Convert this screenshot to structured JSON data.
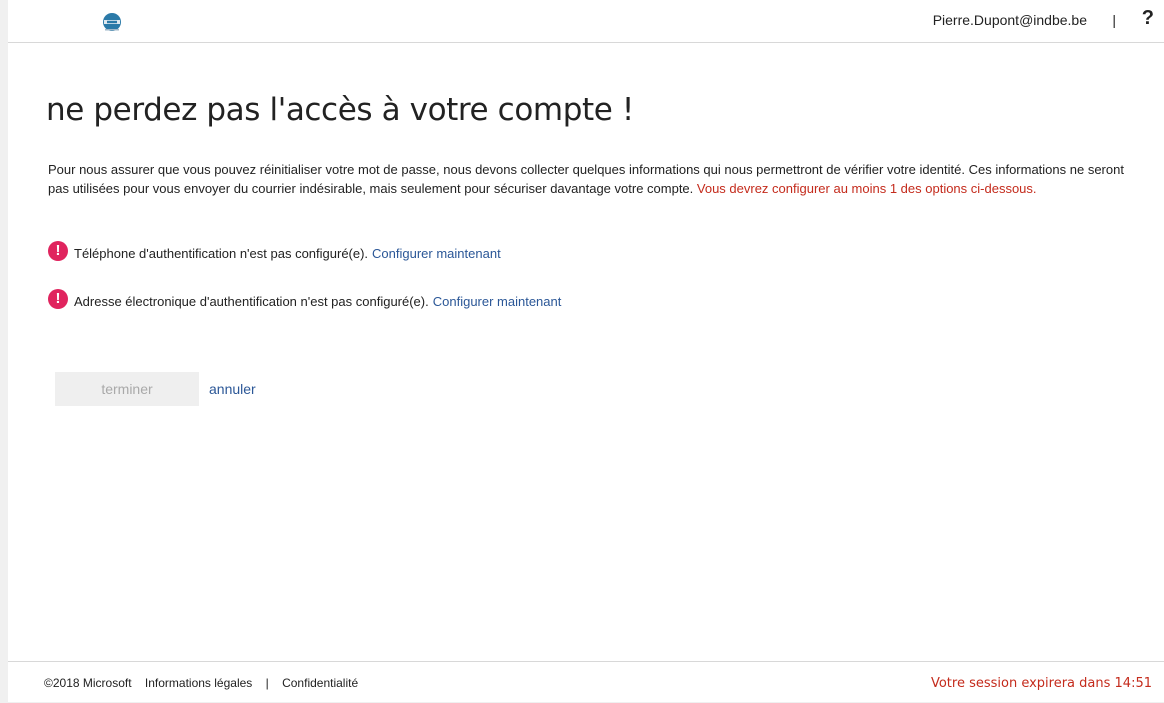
{
  "header": {
    "user_email": "Pierre.Dupont@indbe.be",
    "separator": "|",
    "help_label": "?"
  },
  "main": {
    "title": "ne perdez pas l'accès à votre compte !",
    "intro_text": "Pour nous assurer que vous pouvez réinitialiser votre mot de passe, nous devons collecter quelques informations qui nous permettront de vérifier votre identité. Ces informations ne seront pas utilisées pour vous envoyer du courrier indésirable, mais seulement pour sécuriser davantage votre compte. ",
    "intro_warning": "Vous devrez configurer au moins 1 des options ci-dessous.",
    "options": [
      {
        "status_text": "Téléphone d'authentification n'est pas configuré(e).",
        "link_label": "Configurer maintenant",
        "icon": "exclamation-icon"
      },
      {
        "status_text": "Adresse électronique d'authentification n'est pas configuré(e).",
        "link_label": "Configurer maintenant",
        "icon": "exclamation-icon"
      }
    ],
    "finish_label": "terminer",
    "cancel_label": "annuler"
  },
  "footer": {
    "copyright": "©2018 Microsoft",
    "legal_link": "Informations légales",
    "separator": "|",
    "privacy_link": "Confidentialité",
    "session_text": "Votre session expirera dans 14:51"
  },
  "colors": {
    "accent_link": "#2b5797",
    "warning": "#c42b1c",
    "alert_icon": "#e0245e"
  }
}
